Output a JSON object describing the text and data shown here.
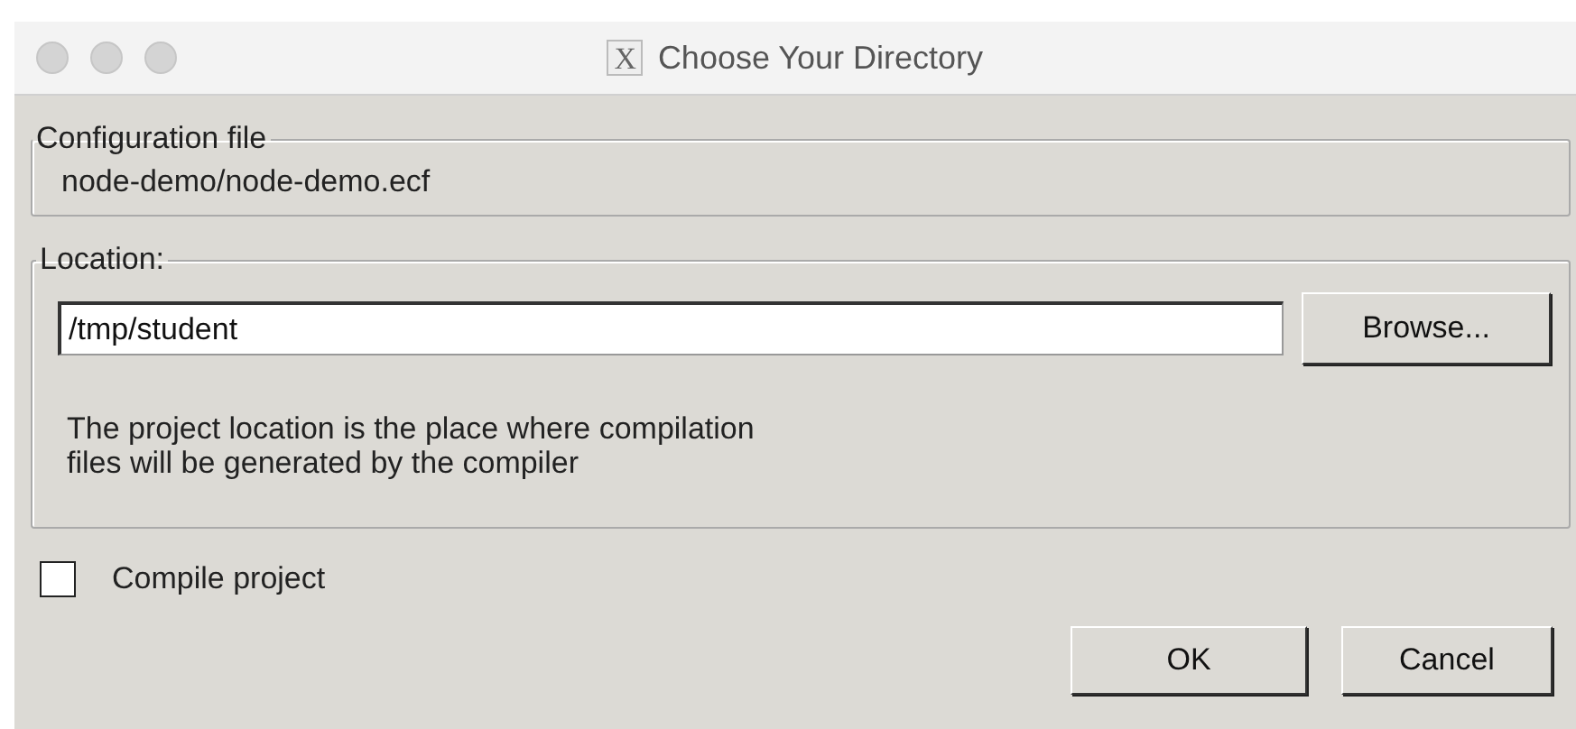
{
  "window": {
    "title": "Choose Your Directory",
    "title_icon": "X"
  },
  "configuration_file": {
    "label": "Configuration file",
    "value": "node-demo/node-demo.ecf"
  },
  "location": {
    "label": "Location:",
    "value": "/tmp/student",
    "browse_button": "Browse...",
    "help_lines": [
      "The project location is the place where compilation",
      "files will be generated by the compiler"
    ]
  },
  "compile_project": {
    "label": "Compile project",
    "checked": false
  },
  "buttons": [
    {
      "label": "OK",
      "kind": "ok"
    },
    {
      "label": "Cancel",
      "kind": "cancel"
    }
  ]
}
